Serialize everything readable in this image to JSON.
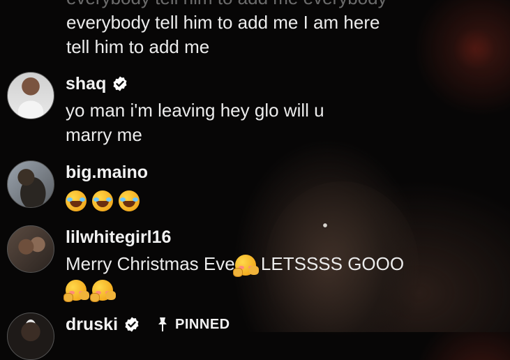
{
  "continued_comment": {
    "faded_line": "everybody tell him to add me everybody",
    "lines": [
      "everybody tell him to add me I am here",
      "tell him to add me"
    ]
  },
  "comments": [
    {
      "username": "shaq",
      "verified": true,
      "avatar": "shaq-avatar",
      "lines": [
        "yo man i'm leaving hey glo will u",
        "marry me"
      ]
    },
    {
      "username": "big.maino",
      "verified": false,
      "avatar": "big-maino-avatar",
      "emojis": [
        "face-with-tears-of-joy",
        "face-with-tears-of-joy",
        "face-with-tears-of-joy"
      ]
    },
    {
      "username": "lilwhitegirl16",
      "verified": false,
      "avatar": "lilwhitegirl16-avatar",
      "text_before_emoji": "Merry Christmas Eve",
      "inline_emoji": "smiling-face-with-hearts",
      "text_after_emoji": " LETSSSS GOOO",
      "emojis_second_line": [
        "smiling-face-with-hearts",
        "smiling-face-with-hearts"
      ]
    },
    {
      "username": "druski",
      "verified": true,
      "avatar": "druski-avatar",
      "pinned_label": "PINNED",
      "pin_icon": "pin-icon"
    }
  ],
  "colors": {
    "text": "#ececec",
    "background": "#070606",
    "verified_badge": "#ffffff"
  }
}
